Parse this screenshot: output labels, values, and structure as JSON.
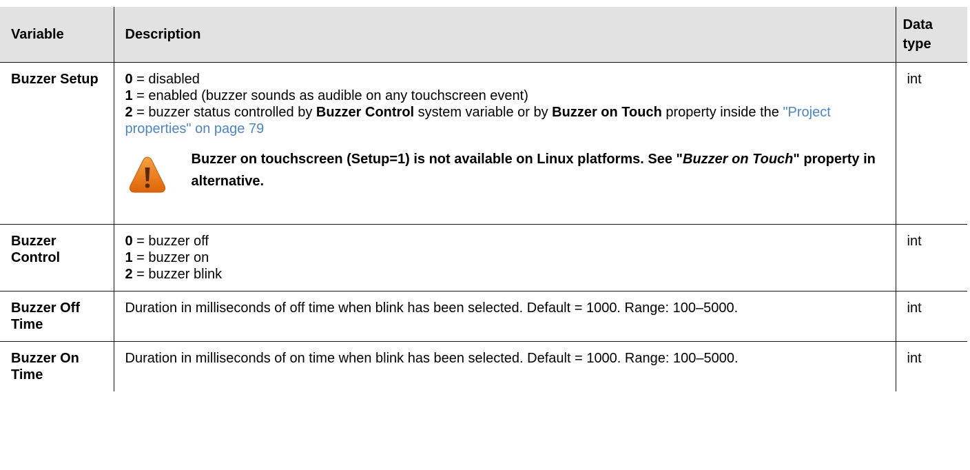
{
  "headers": {
    "variable": "Variable",
    "description": "Description",
    "data_type": "Data type"
  },
  "rows": [
    {
      "variable": "Buzzer Setup",
      "type": "int",
      "lines": [
        {
          "key": "0",
          "text": " = disabled"
        },
        {
          "key": "1",
          "text": " = enabled (buzzer sounds as audible on any touchscreen event)"
        },
        {
          "key": "2",
          "text_a": " = buzzer status controlled by ",
          "bold_a": "Buzzer Control",
          "text_b": " system variable or by ",
          "bold_b": "Buzzer on Touch",
          "text_c": " property inside the ",
          "link": "\"Project properties\" on page 79"
        }
      ],
      "note": {
        "icon": "warning-icon",
        "text_a": "Buzzer on touchscreen (Setup=1) is not available on Linux platforms. See \"",
        "italic": "Buzzer on Touch",
        "text_b": "\" property in alternative."
      }
    },
    {
      "variable": "Buzzer Control",
      "type": "int",
      "lines": [
        {
          "key": "0",
          "text": " = buzzer off"
        },
        {
          "key": "1",
          "text": " = buzzer on"
        },
        {
          "key": "2",
          "text": " = buzzer blink"
        }
      ]
    },
    {
      "variable": "Buzzer Off Time",
      "type": "int",
      "description": "Duration in milliseconds of off time when blink has been selected. Default = 1000. Range: 100–5000."
    },
    {
      "variable": "Buzzer On Time",
      "type": "int",
      "description": "Duration in milliseconds of on time when blink has been selected. Default = 1000. Range: 100–5000."
    }
  ],
  "colors": {
    "header_bg": "#e2e2e2",
    "link": "#4a86c5",
    "icon_orange": "#ee7b16"
  }
}
